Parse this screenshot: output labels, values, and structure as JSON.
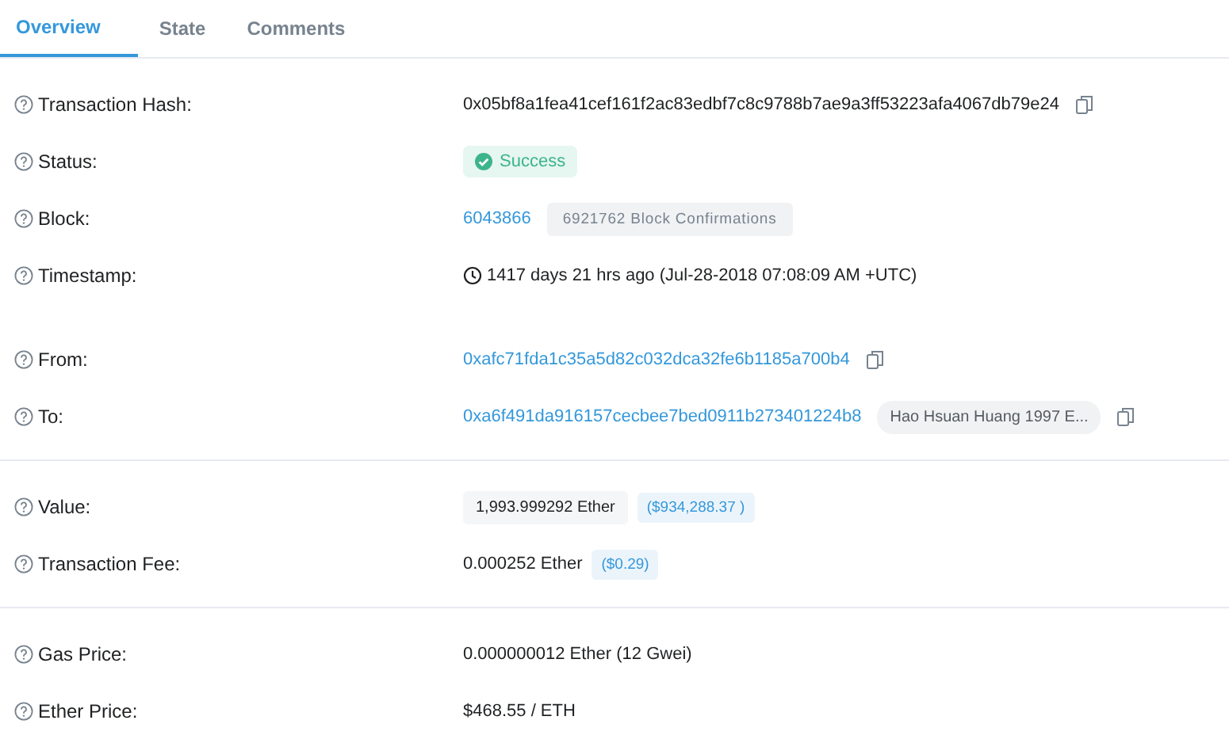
{
  "tabs": [
    {
      "label": "Overview",
      "selected": true
    },
    {
      "label": "State",
      "selected": false
    },
    {
      "label": "Comments",
      "selected": false
    }
  ],
  "sections": [
    {
      "groups": [
        [
          {
            "label": "Transaction Hash:",
            "parts": [
              {
                "kind": "text",
                "text": "0x05bf8a1fea41cef161f2ac83edbf7c8c9788b7ae9a3ff53223afa4067db79e24"
              },
              {
                "kind": "copy"
              }
            ]
          },
          {
            "label": "Status:",
            "parts": [
              {
                "kind": "status",
                "text": "Success"
              }
            ]
          },
          {
            "label": "Block:",
            "parts": [
              {
                "kind": "link",
                "text": "6043866"
              },
              {
                "kind": "badge",
                "text": "6921762 Block Confirmations"
              }
            ]
          },
          {
            "label": "Timestamp:",
            "parts": [
              {
                "kind": "clock"
              },
              {
                "kind": "text",
                "text": "1417 days 21 hrs ago (Jul-28-2018 07:08:09 AM +UTC)"
              }
            ]
          }
        ],
        [
          {
            "label": "From:",
            "parts": [
              {
                "kind": "link",
                "text": "0xafc71fda1c35a5d82c032dca32fe6b1185a700b4"
              },
              {
                "kind": "copy"
              }
            ]
          },
          {
            "label": "To:",
            "parts": [
              {
                "kind": "link",
                "text": "0xa6f491da916157cecbee7bed0911b273401224b8"
              },
              {
                "kind": "pill",
                "text": "Hao Hsuan Huang 1997 E..."
              },
              {
                "kind": "copy"
              }
            ]
          }
        ]
      ]
    },
    {
      "groups": [
        [
          {
            "label": "Value:",
            "parts": [
              {
                "kind": "amount",
                "text": "1,993.999292 Ether"
              },
              {
                "kind": "usd",
                "text": "($934,288.37 )"
              }
            ]
          },
          {
            "label": "Transaction Fee:",
            "parts": [
              {
                "kind": "text",
                "text": "0.000252 Ether"
              },
              {
                "kind": "usd",
                "text": "($0.29)"
              }
            ]
          }
        ]
      ]
    },
    {
      "groups": [
        [
          {
            "label": "Gas Price:",
            "parts": [
              {
                "kind": "text",
                "text": "0.000000012 Ether (12 Gwei)"
              }
            ]
          },
          {
            "label": "Ether Price:",
            "parts": [
              {
                "kind": "text",
                "text": "$468.55 / ETH"
              }
            ]
          }
        ]
      ]
    }
  ]
}
